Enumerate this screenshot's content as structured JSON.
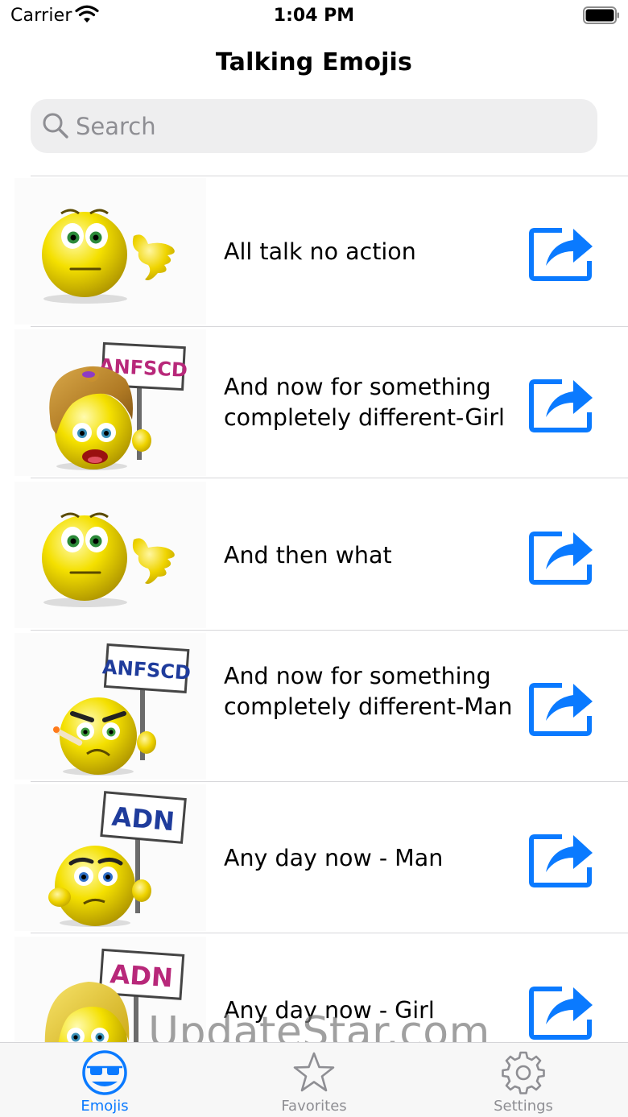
{
  "status_bar": {
    "carrier": "Carrier",
    "time": "1:04 PM"
  },
  "nav": {
    "title": "Talking Emojis"
  },
  "search": {
    "placeholder": "Search",
    "value": ""
  },
  "rows": [
    {
      "label": "All talk no action",
      "sign": "",
      "sign_color": "",
      "emoji": "smiley-pointing"
    },
    {
      "label": "And now for something completely different-Girl",
      "sign": "ANFSCD",
      "sign_color": "#b8287a",
      "emoji": "girl-with-sign"
    },
    {
      "label": "And then what",
      "sign": "",
      "sign_color": "",
      "emoji": "smiley-pointing"
    },
    {
      "label": "And now for something completely different-Man",
      "sign": "ANFSCD",
      "sign_color": "#1f3c9c",
      "emoji": "man-with-sign"
    },
    {
      "label": "Any day now - Man",
      "sign": "ADN",
      "sign_color": "#1f3c9c",
      "emoji": "man-with-sign"
    },
    {
      "label": "Any day now - Girl",
      "sign": "ADN",
      "sign_color": "#b8287a",
      "emoji": "girl-with-sign"
    }
  ],
  "tabs": [
    {
      "label": "Emojis",
      "icon": "emoji-glasses-icon",
      "active": true
    },
    {
      "label": "Favorites",
      "icon": "star-icon",
      "active": false
    },
    {
      "label": "Settings",
      "icon": "gear-icon",
      "active": false
    }
  ],
  "watermark": "UpdateStar.com",
  "colors": {
    "accent": "#0a7aff",
    "inactive_tab": "#8e8e93",
    "emoji_yellow": "#f4e000"
  }
}
